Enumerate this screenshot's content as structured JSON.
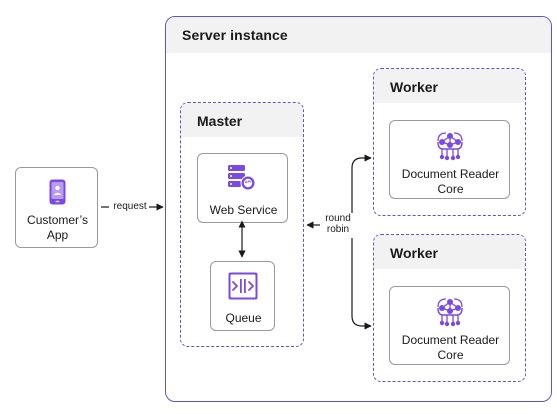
{
  "server": {
    "title": "Server instance"
  },
  "customer": {
    "label": "Customer’s App",
    "icon": "mobile-user-icon"
  },
  "edges": {
    "request": "request",
    "balancing": "round robin"
  },
  "master": {
    "title": "Master",
    "web_service": {
      "label": "Web Service",
      "icon": "api-server-icon",
      "badge": "API"
    },
    "queue": {
      "label": "Queue",
      "icon": "queue-icon"
    }
  },
  "workers": [
    {
      "title": "Worker",
      "node_label": "Document Reader Core",
      "icon": "neural-network-icon"
    },
    {
      "title": "Worker",
      "node_label": "Document Reader Core",
      "icon": "neural-network-icon"
    }
  ],
  "colors": {
    "accent": "#6a4fc2",
    "icon": "#7b4ae2",
    "header_fill": "#f2f2f2",
    "border": "#9a9a9a"
  }
}
